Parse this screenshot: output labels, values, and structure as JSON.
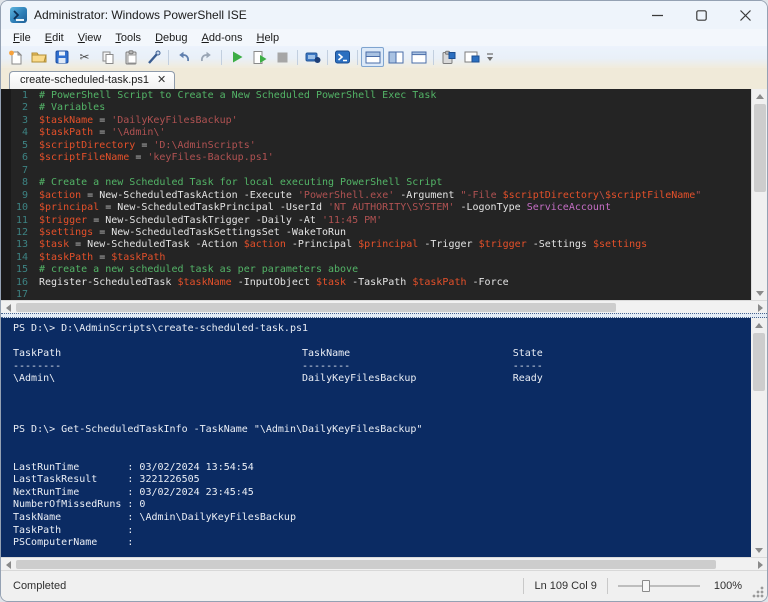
{
  "window": {
    "title": "Administrator: Windows PowerShell ISE",
    "controls": [
      "minimize",
      "maximize",
      "close"
    ]
  },
  "menu": {
    "items": [
      "File",
      "Edit",
      "View",
      "Tools",
      "Debug",
      "Add-ons",
      "Help"
    ]
  },
  "toolbar": {
    "icons": [
      "new-script",
      "open-script",
      "save",
      "cut",
      "copy",
      "paste",
      "clear-console",
      "undo",
      "redo",
      "run-script",
      "run-selection",
      "stop-operation",
      "new-remote-powershell-tab",
      "start-powershell",
      "show-script-pane-top",
      "show-script-pane-right",
      "show-script-pane-maximized",
      "show-command-window",
      "show-script-pane",
      "toolbar-overflow"
    ]
  },
  "tab": {
    "label": "create-scheduled-task.ps1",
    "close_glyph": "✕"
  },
  "editor": {
    "language": "powershell",
    "lines": [
      {
        "n": 1,
        "t": [
          [
            "cm",
            "# PowerShell Script to Create a New Scheduled PowerShell Exec Task"
          ]
        ]
      },
      {
        "n": 2,
        "t": [
          [
            "cm",
            "# Variables"
          ]
        ]
      },
      {
        "n": 3,
        "t": [
          [
            "v",
            "$taskName"
          ],
          [
            "o",
            " = "
          ],
          [
            "s",
            "'DailyKeyFilesBackup'"
          ]
        ]
      },
      {
        "n": 4,
        "t": [
          [
            "v",
            "$taskPath"
          ],
          [
            "o",
            " = "
          ],
          [
            "s",
            "'\\Admin\\'"
          ]
        ]
      },
      {
        "n": 5,
        "t": [
          [
            "v",
            "$scriptDirectory"
          ],
          [
            "o",
            " = "
          ],
          [
            "s",
            "'D:\\AdminScripts'"
          ]
        ]
      },
      {
        "n": 6,
        "t": [
          [
            "v",
            "$scriptFileName"
          ],
          [
            "o",
            " = "
          ],
          [
            "s",
            "'keyFiles-Backup.ps1'"
          ]
        ]
      },
      {
        "n": 7,
        "t": []
      },
      {
        "n": 8,
        "t": [
          [
            "cm",
            "# Create a new Scheduled Task for local executing PowerShell Script"
          ]
        ]
      },
      {
        "n": 9,
        "t": [
          [
            "v",
            "$action"
          ],
          [
            "o",
            " = "
          ],
          [
            "d",
            "New-ScheduledTaskAction -Execute "
          ],
          [
            "s",
            "'PowerShell.exe'"
          ],
          [
            "d",
            " -Argument "
          ],
          [
            "s",
            "\"-File "
          ],
          [
            "v",
            "$scriptDirectory"
          ],
          [
            "s",
            "\\"
          ],
          [
            "v",
            "$scriptFileName"
          ],
          [
            "s",
            "\""
          ]
        ]
      },
      {
        "n": 10,
        "t": [
          [
            "v",
            "$principal"
          ],
          [
            "o",
            " = "
          ],
          [
            "d",
            "New-ScheduledTaskPrincipal -UserId "
          ],
          [
            "s",
            "'NT AUTHORITY\\SYSTEM'"
          ],
          [
            "d",
            " -LogonType "
          ],
          [
            "k",
            "ServiceAccount"
          ]
        ]
      },
      {
        "n": 11,
        "t": [
          [
            "v",
            "$trigger"
          ],
          [
            "o",
            " = "
          ],
          [
            "d",
            "New-ScheduledTaskTrigger -Daily -At "
          ],
          [
            "s",
            "'11:45 PM'"
          ]
        ]
      },
      {
        "n": 12,
        "t": [
          [
            "v",
            "$settings"
          ],
          [
            "o",
            " = "
          ],
          [
            "d",
            "New-ScheduledTaskSettingsSet -WakeToRun"
          ]
        ]
      },
      {
        "n": 13,
        "t": [
          [
            "v",
            "$task"
          ],
          [
            "o",
            " = "
          ],
          [
            "d",
            "New-ScheduledTask -Action "
          ],
          [
            "v",
            "$action"
          ],
          [
            "d",
            " -Principal "
          ],
          [
            "v",
            "$principal"
          ],
          [
            "d",
            " -Trigger "
          ],
          [
            "v",
            "$trigger"
          ],
          [
            "d",
            " -Settings "
          ],
          [
            "v",
            "$settings"
          ]
        ]
      },
      {
        "n": 14,
        "t": [
          [
            "v",
            "$taskPath"
          ],
          [
            "o",
            " = "
          ],
          [
            "v",
            "$taskPath"
          ]
        ]
      },
      {
        "n": 15,
        "t": [
          [
            "cm",
            "# create a new scheduled task as per parameters above"
          ]
        ]
      },
      {
        "n": 16,
        "t": [
          [
            "d",
            "Register-ScheduledTask "
          ],
          [
            "v",
            "$taskName"
          ],
          [
            "d",
            " -InputObject "
          ],
          [
            "v",
            "$task"
          ],
          [
            "d",
            " -TaskPath "
          ],
          [
            "v",
            "$taskPath"
          ],
          [
            "d",
            " -Force"
          ]
        ]
      },
      {
        "n": 17,
        "t": []
      }
    ]
  },
  "console": {
    "lines": [
      "PS D:\\> D:\\AdminScripts\\create-scheduled-task.ps1",
      "",
      "TaskPath                                        TaskName                           State",
      "--------                                        --------                           -----",
      "\\Admin\\                                         DailyKeyFilesBackup                Ready",
      "",
      "",
      "",
      "PS D:\\> Get-ScheduledTaskInfo -TaskName \"\\Admin\\DailyKeyFilesBackup\"",
      "",
      "",
      "LastRunTime        : 03/02/2024 13:54:54",
      "LastTaskResult     : 3221226505",
      "NextRunTime        : 03/02/2024 23:45:45",
      "NumberOfMissedRuns : 0",
      "TaskName           : \\Admin\\DailyKeyFilesBackup",
      "TaskPath           :",
      "PSComputerName     :"
    ]
  },
  "statusbar": {
    "status": "Completed",
    "position": "Ln 109 Col 9",
    "zoom": "100%"
  }
}
